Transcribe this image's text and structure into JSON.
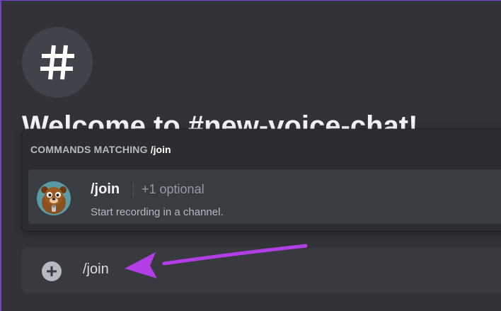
{
  "channel": {
    "icon": "hash-icon",
    "welcome_title": "Welcome to #new-voice-chat!"
  },
  "autocomplete": {
    "header_prefix": "COMMANDS MATCHING",
    "header_query": "/join",
    "commands": [
      {
        "name": "/join",
        "optional": "+1 optional",
        "description": "Start recording in a channel.",
        "avatar_icon": "beaver-bot-avatar"
      }
    ]
  },
  "message_input": {
    "value": "/join",
    "plus_icon": "plus-circle-icon"
  },
  "annotation": {
    "arrow_color": "#b43ee6"
  },
  "colors": {
    "background": "#313338",
    "popup": "#2b2d31",
    "selected_row": "#393c41",
    "input_bar": "#383a40"
  }
}
